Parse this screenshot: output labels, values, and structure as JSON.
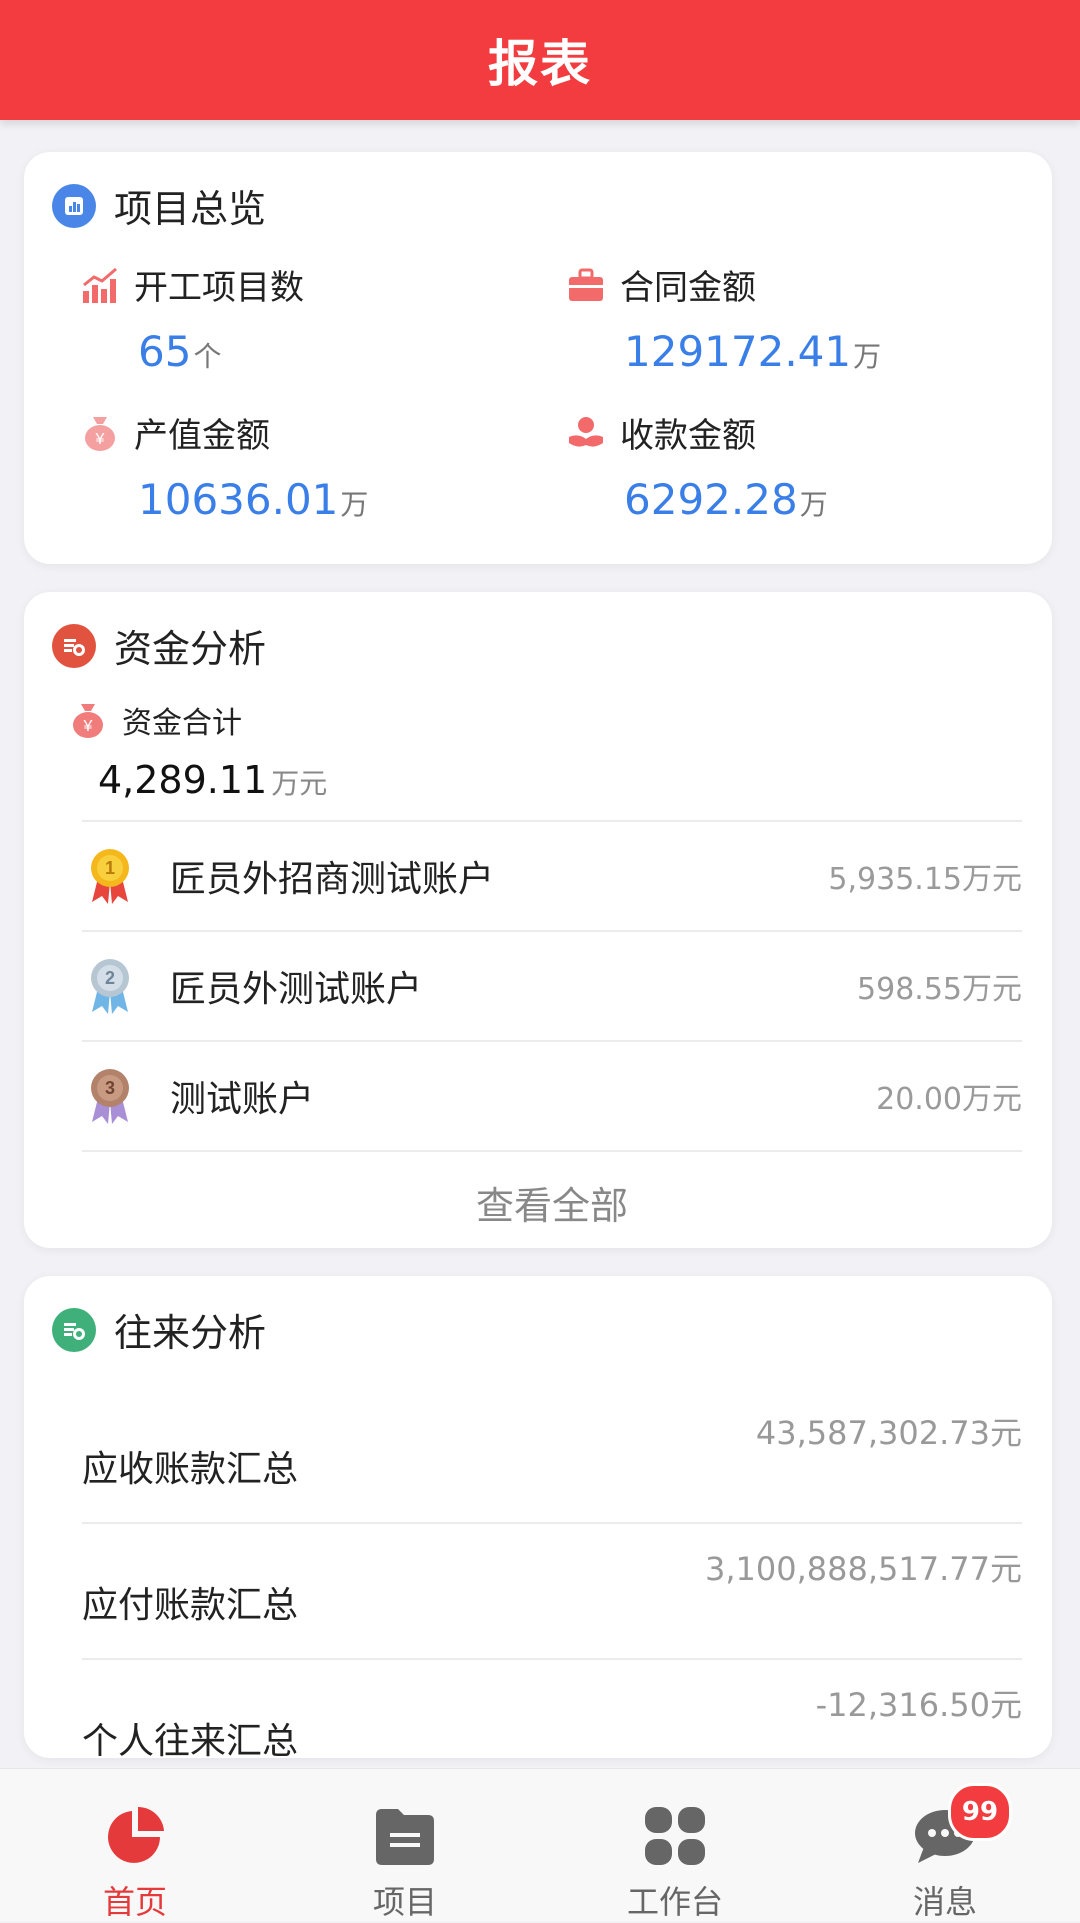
{
  "header": {
    "title": "报表"
  },
  "overview": {
    "title": "项目总览",
    "items": [
      {
        "label": "开工项目数",
        "value": "65",
        "unit": "个"
      },
      {
        "label": "合同金额",
        "value": "129172.41",
        "unit": "万"
      },
      {
        "label": "产值金额",
        "value": "10636.01",
        "unit": "万"
      },
      {
        "label": "收款金额",
        "value": "6292.28",
        "unit": "万"
      }
    ]
  },
  "funds": {
    "title": "资金分析",
    "total_label": "资金合计",
    "total_value": "4,289.11",
    "total_unit": "万元",
    "rows": [
      {
        "rank": "1",
        "name": "匠员外招商测试账户",
        "amount": "5,935.15万元"
      },
      {
        "rank": "2",
        "name": "匠员外测试账户",
        "amount": "598.55万元"
      },
      {
        "rank": "3",
        "name": "测试账户",
        "amount": "20.00万元"
      }
    ],
    "view_all": "查看全部"
  },
  "exchange": {
    "title": "往来分析",
    "rows": [
      {
        "name": "应收账款汇总",
        "amount": "43,587,302.73元"
      },
      {
        "name": "应付账款汇总",
        "amount": "3,100,888,517.77元"
      },
      {
        "name": "个人往来汇总",
        "amount": "-12,316.50元"
      }
    ]
  },
  "tabbar": {
    "tabs": [
      {
        "label": "首页",
        "icon": "pie-chart-icon",
        "active": true
      },
      {
        "label": "项目",
        "icon": "folder-icon",
        "active": false
      },
      {
        "label": "工作台",
        "icon": "grid-icon",
        "active": false
      },
      {
        "label": "消息",
        "icon": "chat-icon",
        "active": false,
        "badge": "99"
      }
    ]
  },
  "colors": {
    "brand_red": "#f23c3f",
    "value_blue": "#3a7ee8",
    "muted_gray": "#999999"
  }
}
